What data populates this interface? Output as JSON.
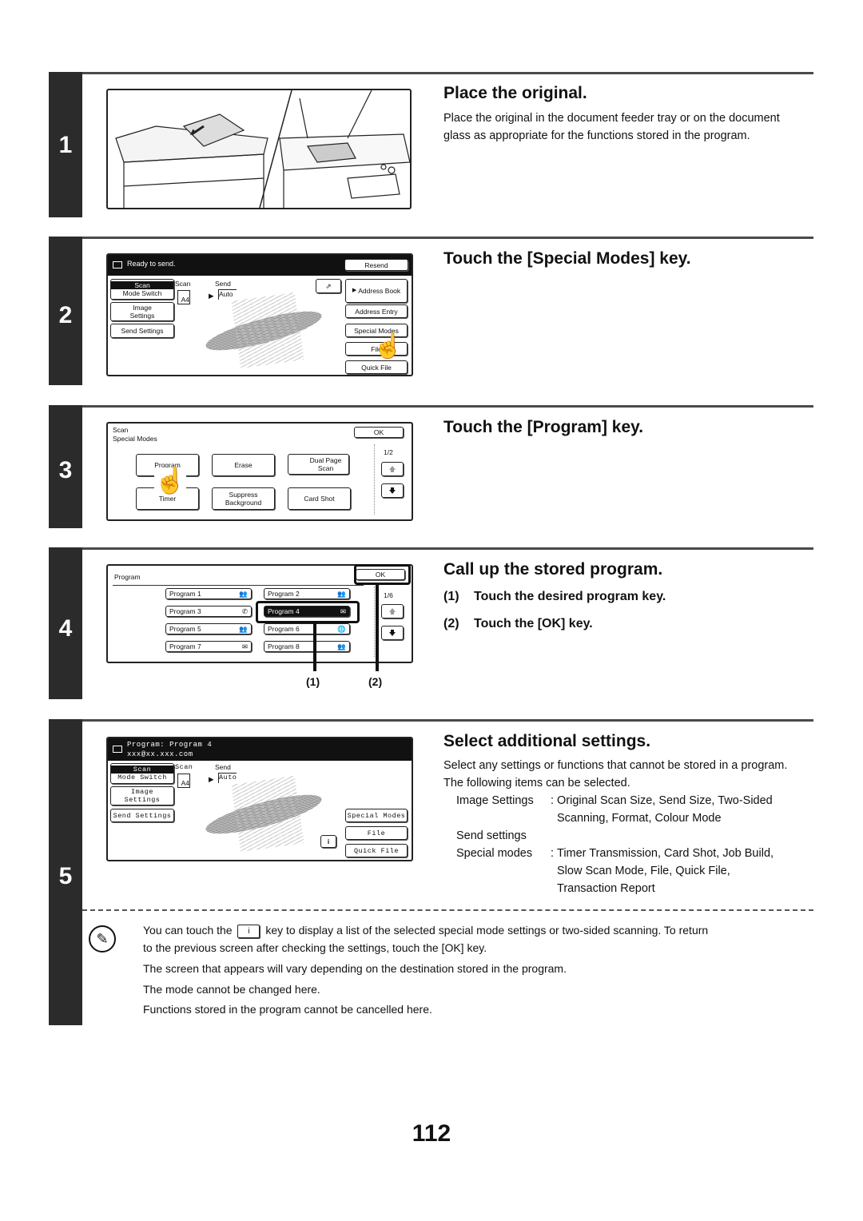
{
  "page_number": "112",
  "steps": [
    {
      "number": "1",
      "title": "Place the original.",
      "text": "Place the original in the document feeder tray or on the document glass as appropriate for the functions stored in the program.",
      "illustration": "copier-document-feeder-and-glass"
    },
    {
      "number": "2",
      "title": "Touch the [Special Modes] key.",
      "screen": {
        "status": "Ready to send.",
        "resend": "Resend",
        "mode_scan": "Scan",
        "mode_switch": "Mode Switch",
        "image_settings_1": "Image",
        "image_settings_2": "Settings",
        "send_settings": "Send Settings",
        "scan_label": "Scan",
        "send_label": "Send",
        "scan_size": "A4",
        "send_size": "Auto",
        "address_book": "Address Book",
        "address_entry": "Address Entry",
        "special_modes": "Special Modes",
        "file": "File",
        "quick_file": "Quick File"
      }
    },
    {
      "number": "3",
      "title": "Touch the [Program] key.",
      "screen": {
        "title_1": "Scan",
        "title_2": "Special Modes",
        "ok": "OK",
        "page": "1/2",
        "keys": [
          "Program",
          "Erase",
          "Dual Page Scan",
          "Timer",
          "Suppress Background",
          "Card Shot"
        ]
      }
    },
    {
      "number": "4",
      "title": "Call up the stored program.",
      "substeps": [
        {
          "num": "(1)",
          "text": "Touch the desired program key."
        },
        {
          "num": "(2)",
          "text": "Touch the [OK] key."
        }
      ],
      "screen": {
        "title": "Program",
        "ok": "OK",
        "page": "1/6",
        "programs": [
          {
            "label": "Program 1",
            "icon": "group"
          },
          {
            "label": "Program 2",
            "icon": "group"
          },
          {
            "label": "Program 3",
            "icon": "phone"
          },
          {
            "label": "Program 4",
            "icon": "email",
            "selected": true
          },
          {
            "label": "Program 5",
            "icon": "group"
          },
          {
            "label": "Program 6",
            "icon": "globe"
          },
          {
            "label": "Program 7",
            "icon": "email"
          },
          {
            "label": "Program 8",
            "icon": "group"
          }
        ],
        "callouts": [
          "(1)",
          "(2)"
        ]
      }
    },
    {
      "number": "5",
      "title": "Select additional settings.",
      "intro": "Select any settings or functions that cannot be stored in a program. The following items can be selected.",
      "items": [
        {
          "label": "Image Settings",
          "sep": ":",
          "lines": [
            "Original Scan Size, Send Size, Two-Sided",
            "Scanning, Format, Colour Mode"
          ]
        },
        {
          "label": "Send settings",
          "sep": "",
          "lines": []
        },
        {
          "label": "Special modes",
          "sep": ":",
          "lines": [
            "Timer Transmission, Card Shot, Job Build,",
            "Slow Scan Mode, File, Quick File,",
            "Transaction Report"
          ]
        }
      ],
      "screen": {
        "status_1": "Program: Program 4",
        "status_2": "xxx@xx.xxx.com",
        "mode_scan": "Scan",
        "mode_switch": "Mode Switch",
        "image_settings_1": "Image",
        "image_settings_2": "Settings",
        "send_settings": "Send Settings",
        "scan_label": "Scan",
        "send_label": "Send",
        "scan_size": "A4",
        "send_size": "Auto",
        "special_modes": "Special Modes",
        "file": "File",
        "quick_file": "Quick File",
        "info_key": "i"
      }
    }
  ],
  "note": {
    "line1_pre": "You can touch the",
    "line1_key": "i",
    "line1_post": "key to display a list of the selected special mode settings or two-sided scanning. To return",
    "line2": "to the previous screen after checking the settings, touch the [OK] key.",
    "line3": "The screen that appears will vary depending on the destination stored in the program.",
    "line4": "The mode cannot be changed here.",
    "line5": "Functions stored in the program cannot be cancelled here."
  }
}
